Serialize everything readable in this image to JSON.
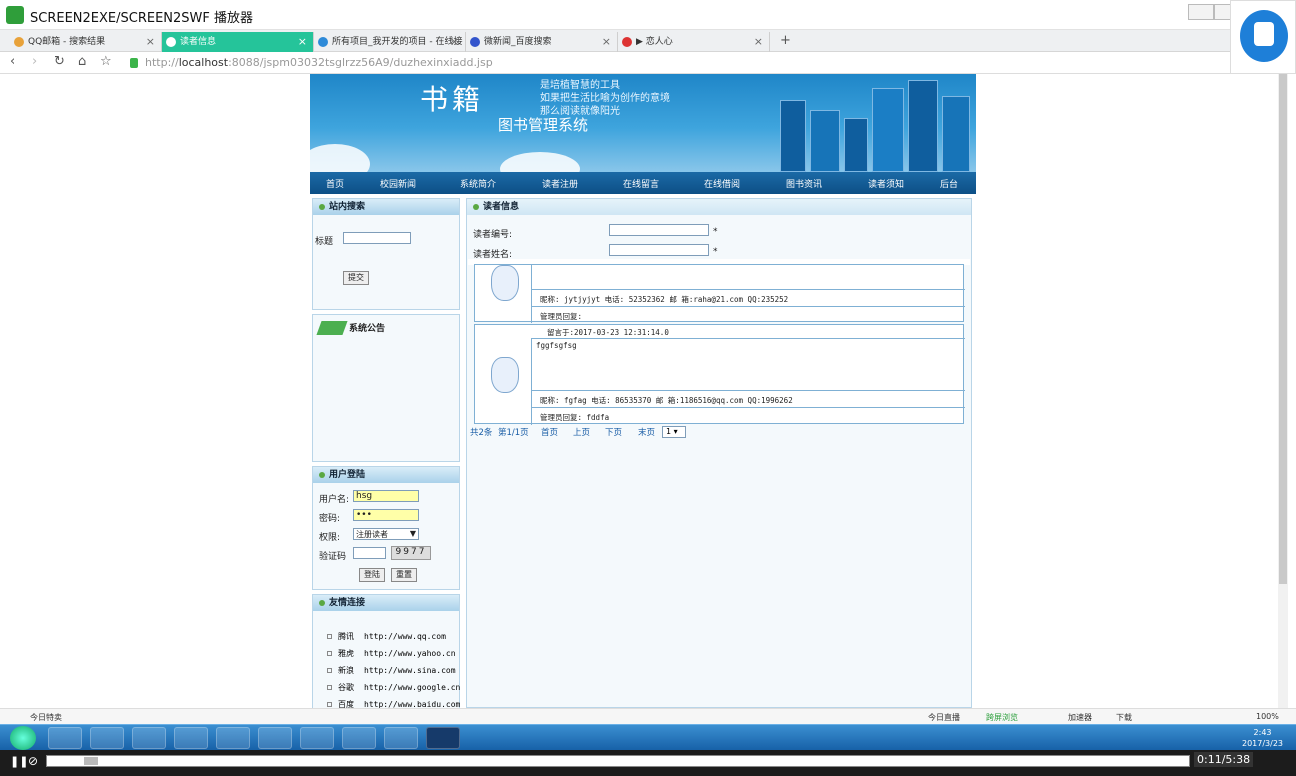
{
  "window": {
    "title": "SCREEN2EXE/SCREEN2SWF 播放器"
  },
  "tabs": [
    {
      "label": "QQ邮箱 - 搜索结果",
      "color": "#e8a23a",
      "active": false
    },
    {
      "label": "读者信息",
      "color": "#25c49a",
      "active": true
    },
    {
      "label": "所有项目_我开发的项目 - 在线接",
      "color": "#2e8ad8",
      "active": false
    },
    {
      "label": "微新闻_百度搜索",
      "color": "#3355cc",
      "active": false
    },
    {
      "label": "▶ 恋人心",
      "color": "#d33",
      "active": false
    }
  ],
  "address": {
    "scheme": "http://",
    "host": "localhost",
    "path": ":8088/jspm03032tsglrzz56A9/duzhexinxiadd.jsp"
  },
  "banner": {
    "logo": "书籍",
    "slogan1": "是培植智慧的工具",
    "slogan2": "如果把生活比喻为创作的意境",
    "slogan3": "那么阅读就像阳光",
    "system": "图书管理系统"
  },
  "nav": [
    "首页",
    "校园新闻",
    "系统简介",
    "读者注册",
    "在线留言",
    "在线借阅",
    "图书资讯",
    "读者须知",
    "后台"
  ],
  "search": {
    "heading": "站内搜索",
    "title_label": "标题",
    "submit": "提交"
  },
  "notice": {
    "heading": "系统公告"
  },
  "login": {
    "heading": "用户登陆",
    "user_label": "用户名:",
    "user_value": "hsg",
    "pwd_label": "密码:",
    "pwd_value": "•••",
    "role_label": "权限:",
    "role_value": "注册读者",
    "code_label": "验证码",
    "code_image": "9977",
    "login_btn": "登陆",
    "reset_btn": "重置"
  },
  "links": {
    "heading": "友情连接",
    "items": [
      {
        "name": "腾讯",
        "url": "http://www.qq.com"
      },
      {
        "name": "雅虎",
        "url": "http://www.yahoo.cn"
      },
      {
        "name": "新浪",
        "url": "http://www.sina.com"
      },
      {
        "name": "谷歌",
        "url": "http://www.google.cn"
      },
      {
        "name": "百度",
        "url": "http://www.baidu.com"
      }
    ]
  },
  "reader": {
    "heading": "读者信息",
    "id_label": "读者编号:",
    "name_label": "读者姓名:",
    "required": "*"
  },
  "messages": [
    {
      "info": "昵称: jytjyjyt    电话: 52352362   邮 箱:raha@21.com    QQ:235252",
      "reply": "管理员回复:"
    },
    {
      "posted": "留言于:2017-03-23 12:31:14.0",
      "body": "fggfsgfsg",
      "info": "昵称: fgfag    电话: 86535370   邮 箱:1186516@qq.com    QQ:1996262",
      "reply": "管理员回复: fddfa"
    }
  ],
  "pager": {
    "total": "共2条",
    "page": "第1/1页",
    "first": "首页",
    "prev": "上页",
    "next": "下页",
    "last": "末页",
    "select": "1"
  },
  "statusbar": {
    "left": "今日特卖",
    "live": "今日直播",
    "phone": "跨屏浏览",
    "accel": "加速器",
    "download": "下载",
    "zoom": "100%"
  },
  "clock": {
    "time": "2:43",
    "date": "2017/3/23"
  },
  "player": {
    "time": "0:11/5:38",
    "progress": 0.033
  }
}
